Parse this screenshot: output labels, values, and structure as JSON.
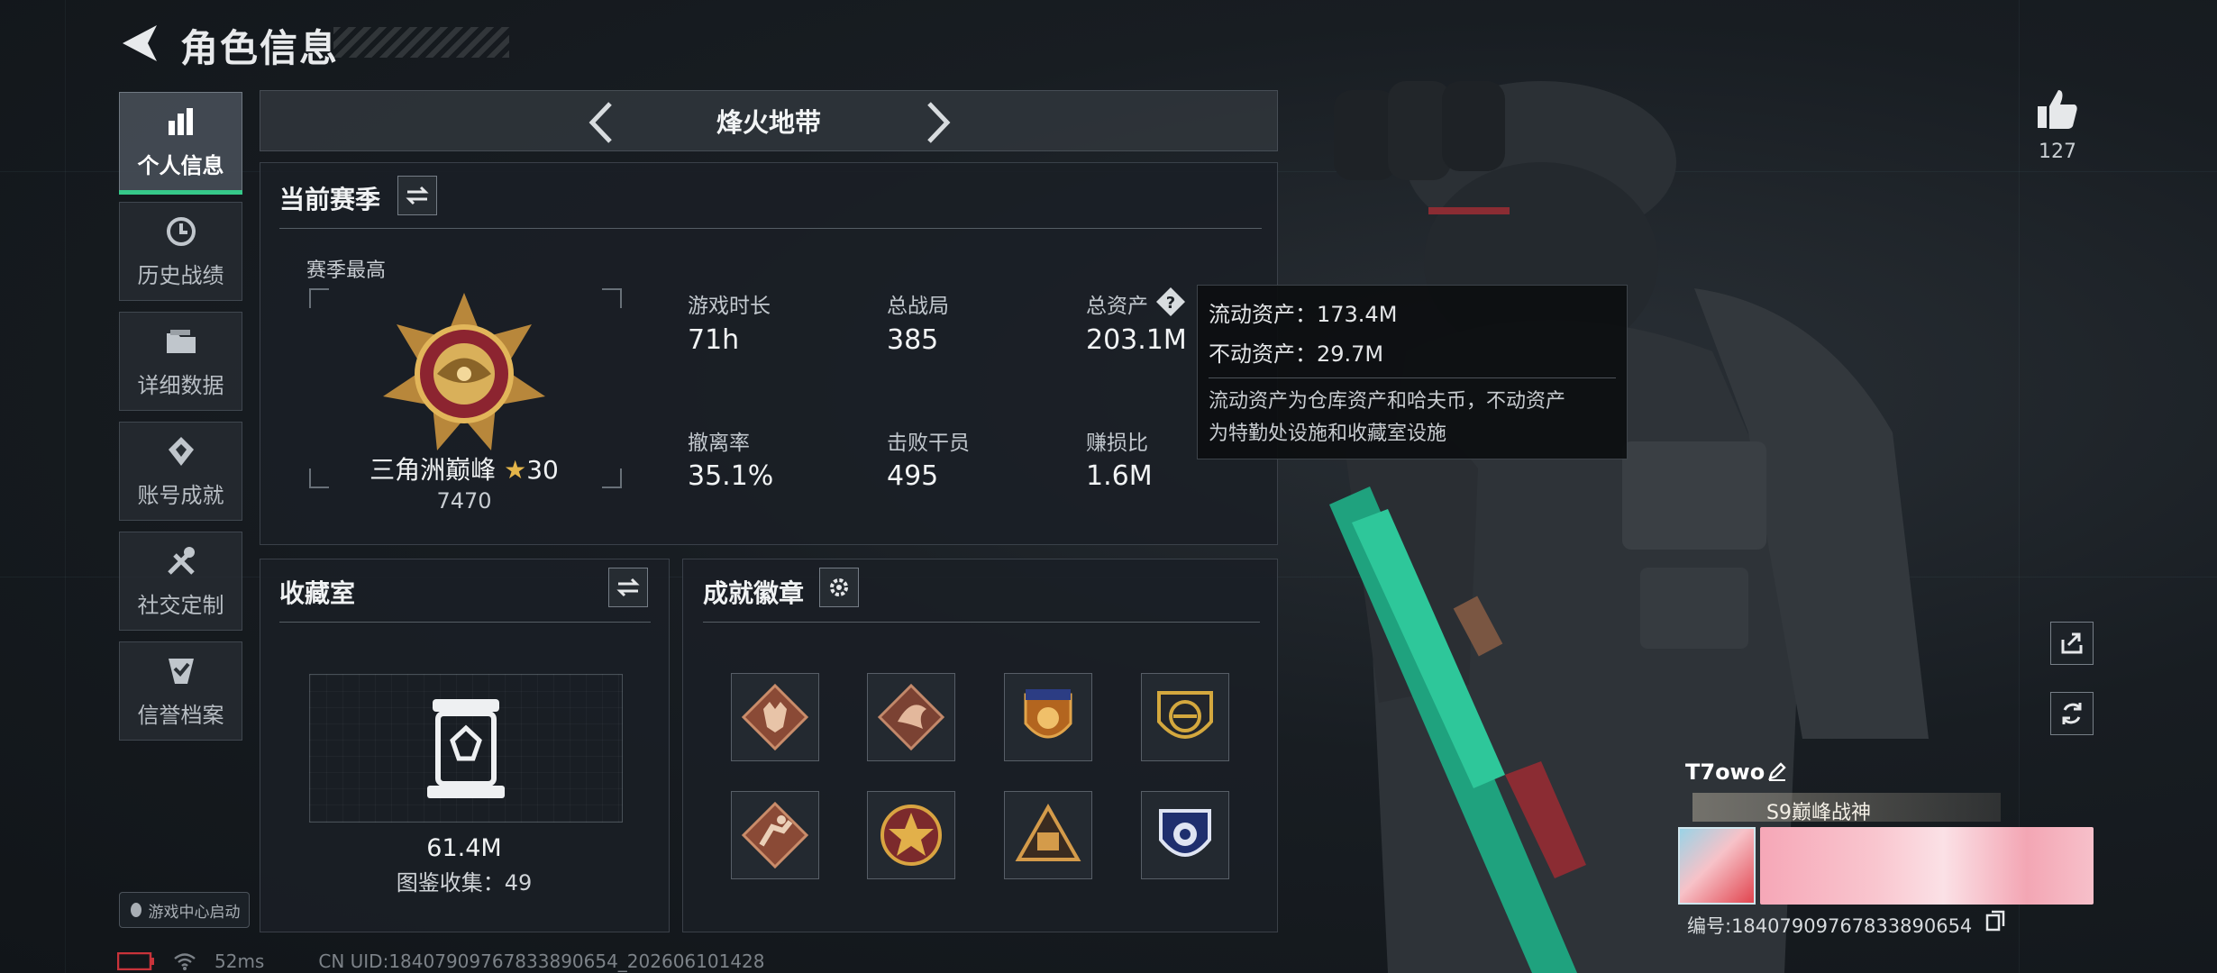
{
  "header": {
    "title": "角色信息"
  },
  "sidebar": {
    "items": [
      {
        "label": "个人信息",
        "icon": "bar-chart-icon",
        "active": true
      },
      {
        "label": "历史战绩",
        "icon": "history-clock-icon",
        "active": false
      },
      {
        "label": "详细数据",
        "icon": "folder-icon",
        "active": false
      },
      {
        "label": "账号成就",
        "icon": "achievement-icon",
        "active": false
      },
      {
        "label": "社交定制",
        "icon": "tools-icon",
        "active": false
      },
      {
        "label": "信誉档案",
        "icon": "shield-check-icon",
        "active": false
      }
    ],
    "launch_badge": "游戏中心启动"
  },
  "mode": {
    "name": "烽火地带"
  },
  "season": {
    "title": "当前赛季",
    "season_high_label": "赛季最高",
    "rank_name": "三角洲巅峰",
    "rank_stars": "30",
    "rank_score": "7470",
    "stats": [
      {
        "label": "游戏时长",
        "value": "71h"
      },
      {
        "label": "总战局",
        "value": "385"
      },
      {
        "label": "总资产",
        "value": "203.1M"
      },
      {
        "label": "撤离率",
        "value": "35.1%"
      },
      {
        "label": "击败干员",
        "value": "495"
      },
      {
        "label": "赚损比",
        "value": "1.6M"
      }
    ]
  },
  "tooltip": {
    "line1": "流动资产：173.4M",
    "line2": "不动资产：29.7M",
    "desc_line1": "流动资产为仓库资产和哈夫币，不动资产",
    "desc_line2": "为特勤处设施和收藏室设施"
  },
  "collection": {
    "title": "收藏室",
    "value": "61.4M",
    "count_text": "图鉴收集：49"
  },
  "badges": {
    "title": "成就徽章",
    "items": [
      {
        "icon": "wolf-badge-icon"
      },
      {
        "icon": "dragon-badge-icon"
      },
      {
        "icon": "crest-badge-icon"
      },
      {
        "icon": "gold-emblem-badge-icon"
      },
      {
        "icon": "runner-badge-icon"
      },
      {
        "icon": "star-badge-icon"
      },
      {
        "icon": "vault-badge-icon"
      },
      {
        "icon": "blue-shield-badge-icon"
      }
    ]
  },
  "player": {
    "likes": "127",
    "name": "T7owo",
    "title_tag": "S9巅峰战神",
    "id_text": "编号:18407909767833890654"
  },
  "status": {
    "ping": "52ms",
    "uid_text": "CN UID:18407909767833890654_202606101428"
  },
  "colors": {
    "accent": "#36c98a",
    "panel_bg": "#1a1f25",
    "text": "#e6e8ea"
  }
}
